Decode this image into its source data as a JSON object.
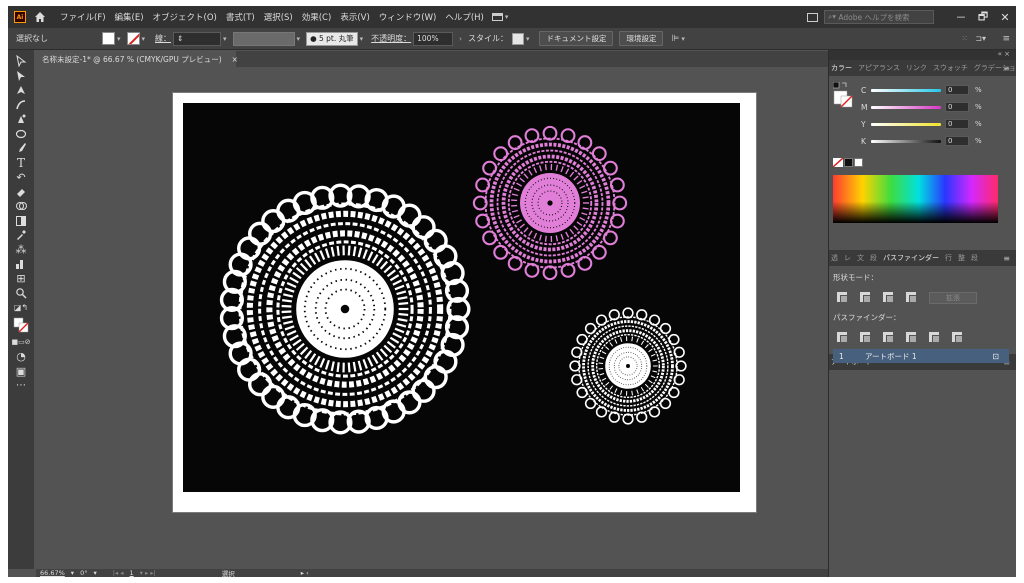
{
  "app": {
    "logo": "Ai",
    "menus": [
      "ファイル(F)",
      "編集(E)",
      "オブジェクト(O)",
      "書式(T)",
      "選択(S)",
      "効果(C)",
      "表示(V)",
      "ウィンドウ(W)",
      "ヘルプ(H)"
    ],
    "search_placeholder": "Adobe ヘルプを検索",
    "window_controls": [
      "－",
      "🗗",
      "✕"
    ]
  },
  "control_bar": {
    "selection": "選択なし",
    "stroke_label": "線：",
    "brush": "● 5 pt. 丸筆",
    "opacity_label": "不透明度：",
    "opacity_value": "100%",
    "style_label": "スタイル：",
    "doc_setup_button": "ドキュメント設定",
    "prefs_button": "環境設定"
  },
  "document_tab": {
    "title": "名称未設定-1* @ 66.67 % (CMYK/GPU プレビュー)",
    "close": "×"
  },
  "status_bar": {
    "zoom": "66.67%",
    "rotation": "0°",
    "artboard_number": "1",
    "tool": "選択"
  },
  "color_panel": {
    "tabs": [
      "カラー",
      "アピアランス",
      "リンク",
      "スウォッチ",
      "グラデーション"
    ],
    "channels": [
      {
        "name": "C",
        "value": "0",
        "unit": "%",
        "color": "#25c7e6"
      },
      {
        "name": "M",
        "value": "0",
        "unit": "%",
        "color": "#d637c4"
      },
      {
        "name": "Y",
        "value": "0",
        "unit": "%",
        "color": "#f0e32a"
      },
      {
        "name": "K",
        "value": "0",
        "unit": "%",
        "color": "#111111"
      }
    ]
  },
  "pathfinder_panel": {
    "tabs": [
      "透",
      "レ",
      "文",
      "段",
      "パスファインダー",
      "行",
      "整",
      "段"
    ],
    "shape_modes_label": "形状モード：",
    "expand_button": "拡張",
    "pathfinders_label": "パスファインダー："
  },
  "artboards_panel": {
    "tab": "アートボード",
    "rows": [
      {
        "index": "1",
        "name": "アートボード 1"
      }
    ]
  },
  "artwork": {
    "background": "#060606",
    "doilies": [
      {
        "name": "large-white-doily",
        "color": "#ffffff"
      },
      {
        "name": "pink-doily",
        "color": "#e07ed8"
      },
      {
        "name": "small-white-doily",
        "color": "#ffffff"
      }
    ]
  }
}
